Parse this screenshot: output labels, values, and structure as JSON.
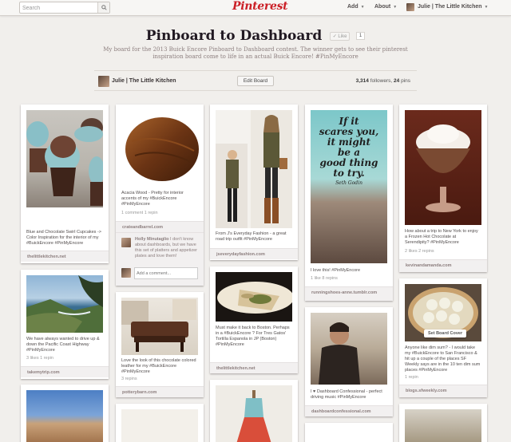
{
  "header": {
    "search_placeholder": "Search",
    "logo": "Pinterest",
    "add": "Add",
    "about": "About",
    "user": "Julie | The Little Kitchen"
  },
  "board": {
    "title": "Pinboard to Dashboard",
    "like_label": "Like",
    "like_count": "1",
    "description": "My board for the 2013 Buick Encore Pinboard to Dashboard contest. The winner gets to see their pinterest inspiration board come to life in an actual Buick Encore! #PinMyEncore",
    "owner": "Julie | The Little Kitchen",
    "edit_button": "Edit Board",
    "followers": "3,314",
    "followers_label": "followers,",
    "pins": "24",
    "pins_label": "pins"
  },
  "pins": {
    "p1": {
      "caption": "Blue and Chocolate Swirl Cupcakes -> Color Inspiration for the interior of my #BuickEncore #PinMyEncore",
      "source": "thelittlekitchen.net"
    },
    "p2": {
      "caption": "We have always wanted to drive up & down the Pacific Coast Highway #PinMyEncore",
      "stats": "3 likes   1 repin",
      "source": "takemytrip.com"
    },
    "p4": {
      "caption": "Acacia Wood - Pretty for interior accents of my #BuickEncore #PinMyEncore",
      "stats": "1 comment   1 repin",
      "source": "crateandbarrel.com",
      "commenter": "Holly Minutaglio",
      "comment": "I don't know about dashboards, but we have this set of platters and appetizer plates and love them!",
      "add_comment_placeholder": "Add a comment..."
    },
    "p5": {
      "caption": "Love the look of this chocolate colored leather for my #BuickEncore #PinMyEncore",
      "stats": "3 repins",
      "source": "potterybarn.com"
    },
    "p7": {
      "caption": "From J's Everyday Fashion - a great road trip outfit #PinMyEncore",
      "source": "jseverydayfashion.com"
    },
    "p8": {
      "caption": "Must make it back to Boston. Perhaps in a #BuickEncore ? For Tres Gatos' Tortilla Espanola in JP (Boston) #PinMyEncore",
      "source": "thelittlekitchen.net"
    },
    "p10": {
      "caption": "I love this! #PinMyEncore",
      "stats": "1 like   8 repins",
      "source": "runningshoes-anne.tumblr.com",
      "image_text": [
        "If it",
        "scares you,",
        "it might",
        "be a",
        "good thing",
        "to try.",
        "Seth Godin"
      ]
    },
    "p11": {
      "caption": "I ♥ Dashboard Confessional - perfect driving music #PinMyEncore",
      "source": "dashboardconfessional.com"
    },
    "p13": {
      "caption": "How about a trip to New York to enjoy a Frozen Hot Chocolate at Serendipity? #PinMyEncore",
      "stats": "2 likes   2 repins",
      "source": "kevinandamanda.com"
    },
    "p14": {
      "caption": "Anyone like dim sum? - I would take my #BuickEncore to San Francisco & hit up a couple of the places SF Weekly says are in the 10 ten dim sum places #PinMyEncore",
      "stats": "1 repin",
      "source": "blogs.sfweekly.com",
      "overlay_button": "Set Board Cover"
    }
  },
  "colors": {
    "brand": "#cb2027",
    "background": "#f1efec"
  }
}
